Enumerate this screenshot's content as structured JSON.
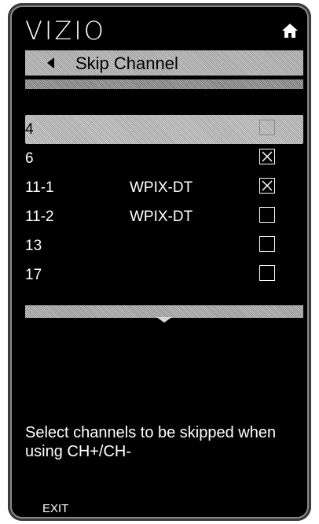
{
  "header": {
    "logo": "VIZIO",
    "icons": {
      "home": "home-icon"
    }
  },
  "titlebar": {
    "title": "Skip Channel",
    "icons": {
      "back": "back-arrow-icon"
    }
  },
  "channels": [
    {
      "number": "4",
      "name": "",
      "skipped": false,
      "selected": true
    },
    {
      "number": "6",
      "name": "",
      "skipped": true,
      "selected": false
    },
    {
      "number": "11-1",
      "name": "WPIX-DT",
      "skipped": true,
      "selected": false
    },
    {
      "number": "11-2",
      "name": "WPIX-DT",
      "skipped": false,
      "selected": false
    },
    {
      "number": "13",
      "name": "",
      "skipped": false,
      "selected": false
    },
    {
      "number": "17",
      "name": "",
      "skipped": false,
      "selected": false
    }
  ],
  "help": {
    "text": "Select channels to be skipped when using CH+/CH-"
  },
  "footer": {
    "exit_label": "EXIT"
  },
  "colors": {
    "background": "#000000",
    "text": "#ffffff",
    "highlight": "#b8b8b8"
  }
}
